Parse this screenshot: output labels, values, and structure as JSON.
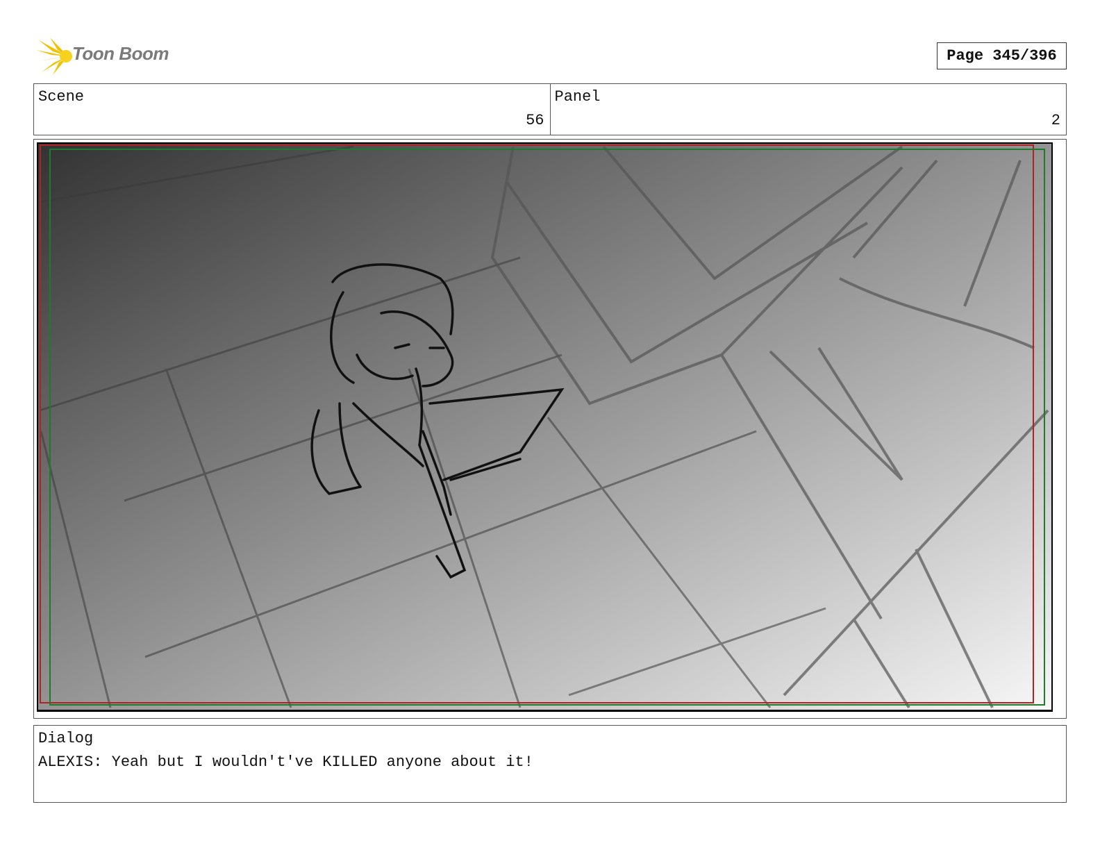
{
  "header": {
    "logo_text": "Toon Boom",
    "page_label": "Page 345/396"
  },
  "scene": {
    "label": "Scene",
    "value": "56"
  },
  "panel": {
    "label": "Panel",
    "value": "2"
  },
  "dialog": {
    "label": "Dialog",
    "text": "ALEXIS: Yeah but I wouldn't've KILLED anyone about it!"
  },
  "colors": {
    "safe_frame_red": "#b22222",
    "safe_frame_green": "#1e7a2e",
    "logo_yellow": "#f2c200",
    "logo_text_gray": "#7a7a7a"
  }
}
